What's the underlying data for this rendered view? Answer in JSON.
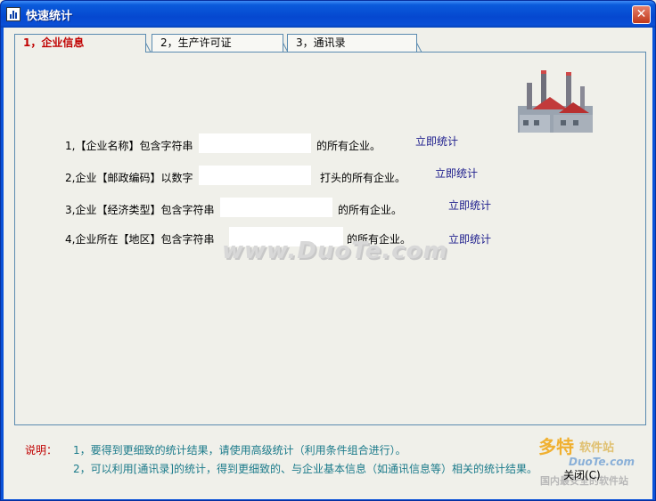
{
  "window": {
    "title": "快速统计",
    "close_glyph": "✕"
  },
  "tabs": [
    {
      "label": "1，企业信息"
    },
    {
      "label": "2，生产许可证"
    },
    {
      "label": "3，通讯录"
    }
  ],
  "rows": [
    {
      "prefix": "1,【企业名称】包含字符串",
      "suffix": "的所有企业。",
      "value": "",
      "action": "立即统计"
    },
    {
      "prefix": "2,企业【邮政编码】以数字",
      "suffix": "打头的所有企业。",
      "value": "",
      "action": "立即统计"
    },
    {
      "prefix": "3,企业【经济类型】包含字符串",
      "suffix": "的所有企业。",
      "value": "",
      "action": "立即统计"
    },
    {
      "prefix": "4,企业所在【地区】包含字符串",
      "suffix": "的所有企业。",
      "value": "",
      "action": "立即统计"
    }
  ],
  "notes": {
    "title": "说明：",
    "line1": "1，要得到更细致的统计结果，请使用高级统计（利用条件组合进行）。",
    "line2": "2，可以利用[通讯录]的统计，得到更细致的、与企业基本信息（如通讯信息等）相关的统计结果。"
  },
  "footer": {
    "close_label": "关闭(C)"
  },
  "watermark": {
    "text": "www.DuoTe.com"
  },
  "corner_logo": {
    "brand": "多特",
    "sub": "软件站",
    "url": "DuoTe.com",
    "tag": "国内最安全的软件站"
  },
  "colors": {
    "title_bar": "#0a52d8",
    "active_tab_text": "#c00000",
    "link": "#1c1c8c",
    "note_text": "#1a7a8a"
  }
}
